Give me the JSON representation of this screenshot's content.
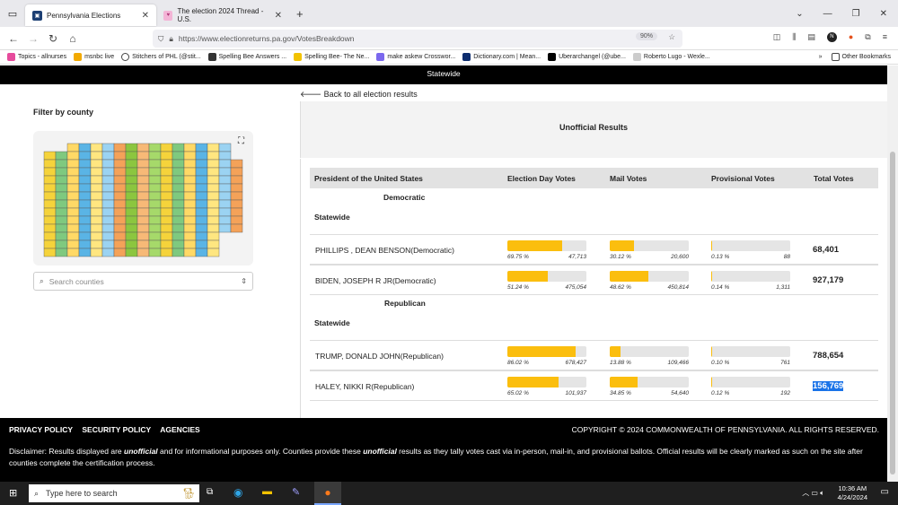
{
  "browser": {
    "tabs": [
      {
        "title": "Pennsylvania Elections",
        "active": true
      },
      {
        "title": "The election 2024 Thread - U.S.",
        "active": false
      }
    ],
    "url": "https://www.electionreturns.pa.gov/VotesBreakdown",
    "zoom": "90%",
    "bookmarks": [
      "Topics - allnurses",
      "msnbc live",
      "Stitchers of PHL (@stit...",
      "Spelling Bee Answers ...",
      "Spelling Bee- The Ne...",
      "make askew Crosswor...",
      "Dictionary.com | Mean...",
      "Uberarchangel (@ube...",
      "Roberto Lugo - Wexle..."
    ],
    "other_bookmarks": "Other Bookmarks"
  },
  "page": {
    "top_label": "Statewide",
    "back_link": "Back to all election results",
    "filter_label": "Filter by county",
    "search_placeholder": "Search counties",
    "unofficial_title": "Unofficial Results",
    "table_header": {
      "office": "President of the United States",
      "election_day": "Election Day Votes",
      "mail": "Mail Votes",
      "provisional": "Provisional Votes",
      "total": "Total Votes"
    },
    "parties": [
      {
        "name": "Democratic",
        "scope": "Statewide",
        "candidates": [
          {
            "name": "PHILLIPS , DEAN BENSON(Democratic)",
            "ed_pct": "69.75 %",
            "ed_votes": "47,713",
            "mail_pct": "30.12 %",
            "mail_votes": "20,600",
            "prov_pct": "0.13 %",
            "prov_votes": "88",
            "total": "68,401",
            "ed_frac": 0.6975,
            "mail_frac": 0.3012,
            "prov_frac": 0.0013
          },
          {
            "name": "BIDEN, JOSEPH R JR(Democratic)",
            "ed_pct": "51.24 %",
            "ed_votes": "475,054",
            "mail_pct": "48.62 %",
            "mail_votes": "450,814",
            "prov_pct": "0.14 %",
            "prov_votes": "1,311",
            "total": "927,179",
            "ed_frac": 0.5124,
            "mail_frac": 0.4862,
            "prov_frac": 0.0014
          }
        ]
      },
      {
        "name": "Republican",
        "scope": "Statewide",
        "candidates": [
          {
            "name": "TRUMP, DONALD JOHN(Republican)",
            "ed_pct": "86.02 %",
            "ed_votes": "678,427",
            "mail_pct": "13.88 %",
            "mail_votes": "109,466",
            "prov_pct": "0.10 %",
            "prov_votes": "761",
            "total": "788,654",
            "ed_frac": 0.8602,
            "mail_frac": 0.1388,
            "prov_frac": 0.001
          },
          {
            "name": "HALEY, NIKKI R(Republican)",
            "ed_pct": "65.02 %",
            "ed_votes": "101,937",
            "mail_pct": "34.85 %",
            "mail_votes": "54,640",
            "prov_pct": "0.12 %",
            "prov_votes": "192",
            "total": "156,769",
            "ed_frac": 0.6502,
            "mail_frac": 0.3485,
            "prov_frac": 0.0012
          }
        ]
      }
    ]
  },
  "footer": {
    "links": [
      "PRIVACY POLICY",
      "SECURITY POLICY",
      "AGENCIES"
    ],
    "copyright": "COPYRIGHT © 2024 COMMONWEALTH OF PENNSYLVANIA. ALL RIGHTS RESERVED.",
    "disclaimer_1": "Disclaimer: Results displayed are ",
    "unofficial_word": "unofficial",
    "disclaimer_2": " and for informational purposes only. Counties provide these ",
    "disclaimer_3": " results as they tally votes cast via in-person, mail-in, and provisional ballots. Official results will be clearly marked as such on the site after counties complete the certification process."
  },
  "taskbar": {
    "search_placeholder": "Type here to search",
    "time": "10:36 AM",
    "date": "4/24/2024"
  },
  "colors": {
    "bar_fill": "#fbbe0e",
    "bar_bg": "#e5e5e5",
    "footer_bg": "#000000"
  }
}
